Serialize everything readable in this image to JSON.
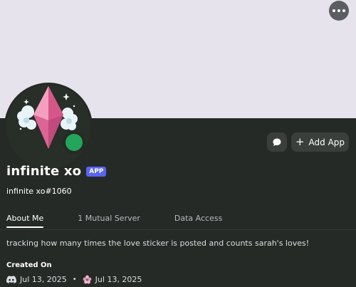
{
  "header": {
    "more_icon": "ellipsis-icon"
  },
  "profile": {
    "display_name": "infinite xo",
    "badge": "APP",
    "username": "infinite xo#1060",
    "status": "online",
    "status_color": "#23a55a"
  },
  "actions": {
    "message_icon": "chat-bubble-icon",
    "add_app_label": "Add App"
  },
  "tabs": [
    {
      "label": "About Me",
      "active": true
    },
    {
      "label": "1 Mutual Server",
      "active": false
    },
    {
      "label": "Data Access",
      "active": false
    }
  ],
  "about": {
    "bio": "tracking how many times the love sticker is posted and counts sarah's loves!",
    "created_label": "Created On",
    "discord_date": "Jul 13, 2025",
    "server_date": "Jul 13, 2025"
  },
  "colors": {
    "banner": "#e7e3ec",
    "panel": "#262a26",
    "accent": "#5865f2"
  }
}
